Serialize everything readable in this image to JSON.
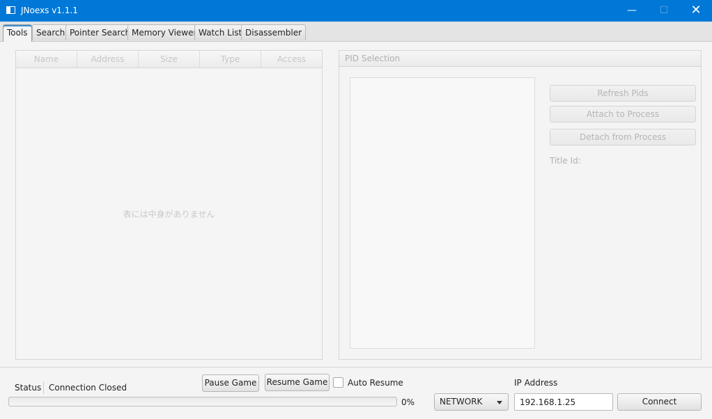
{
  "window": {
    "title": "JNoexs v1.1.1",
    "controls": {
      "minimize": "—",
      "maximize": "☐",
      "close": "✕"
    }
  },
  "tabs": [
    {
      "label": "Tools",
      "active": true
    },
    {
      "label": "Search"
    },
    {
      "label": "Pointer Search"
    },
    {
      "label": "Memory Viewer"
    },
    {
      "label": "Watch List"
    },
    {
      "label": "Disassembler"
    }
  ],
  "table": {
    "columns": [
      "Name",
      "Address",
      "Size",
      "Type",
      "Access"
    ],
    "placeholder": "表には中身がありません"
  },
  "pid_panel": {
    "title": "PID Selection",
    "refresh_label": "Refresh Pids",
    "attach_label": "Attach to Process",
    "detach_label": "Detach from Process",
    "title_id_label": "Title Id:"
  },
  "status": {
    "label": "Status",
    "value": "Connection Closed",
    "progress_text": "0%",
    "progress": 0
  },
  "controls": {
    "pause_label": "Pause Game",
    "resume_label": "Resume Game",
    "auto_resume_label": "Auto Resume",
    "auto_resume_checked": false,
    "ip_label": "IP Address",
    "ip_value": "192.168.1.25",
    "connection_type": "NETWORK",
    "connect_label": "Connect"
  },
  "colors": {
    "titlebar": "#0078d7",
    "tab_accent": "#3a8fd8"
  }
}
